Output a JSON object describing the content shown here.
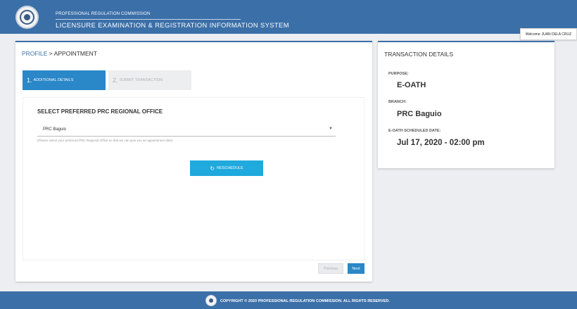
{
  "header": {
    "org_small": "PROFESSIONAL REGULATION COMMISSION",
    "system_title": "LICENSURE EXAMINATION & REGISTRATION INFORMATION SYSTEM",
    "logo_icon": "prc-seal-icon",
    "welcome_label": "Welcome",
    "user_name": "JUAN DELA CRUZ"
  },
  "breadcrumb": {
    "parent": "PROFILE",
    "separator": " > ",
    "current": "APPOINTMENT"
  },
  "steps": [
    {
      "number": "1.",
      "label": "ADDITIONAL DETAILS",
      "active": true
    },
    {
      "number": "2.",
      "label": "SUBMIT TRANSACTION",
      "active": false
    }
  ],
  "form": {
    "title": "SELECT PREFERRED PRC REGIONAL OFFICE",
    "selected_office": "PRC Baguio",
    "help_text": "(Please select your preferred PRC Regional Office so that we can give you an appointment date)",
    "reschedule_label": "RESCHEDULE",
    "reschedule_icon": "reload-icon"
  },
  "nav": {
    "previous_label": "Previous",
    "next_label": "Next"
  },
  "transaction": {
    "title": "TRANSACTION DETAILS",
    "purpose_label": "PURPOSE:",
    "purpose_value": "E-OATH",
    "branch_label": "BRANCH:",
    "branch_value": "PRC Baguio",
    "date_label": "E-OATH SCHEDULED DATE:",
    "date_value": "Jul 17, 2020 - 02:00 pm"
  },
  "footer": {
    "copyright": "COPYRIGHT © 2020 PROFESSIONAL REGULATION COMMISSION. ALL RIGHTS RESERVED."
  },
  "colors": {
    "brand": "#3b6fa8",
    "primary": "#2a87c8",
    "accent": "#1fa9dd",
    "background": "#eceef1"
  }
}
